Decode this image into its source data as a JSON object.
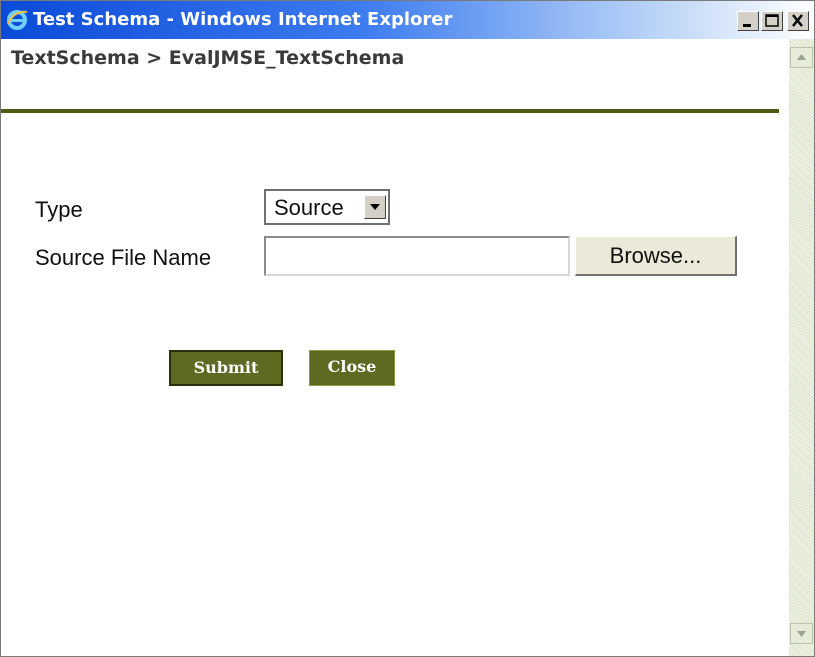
{
  "window": {
    "title": "Test Schema - Windows Internet Explorer",
    "icon": "internet-explorer-icon",
    "controls": [
      "minimize-icon",
      "maximize-icon",
      "close-icon"
    ],
    "title_color": "#0b4ad8"
  },
  "header": {
    "breadcrumb": "TextSchema >  EvalJMSE_TextSchema",
    "rule_color": "#4f5a14"
  },
  "form": {
    "type_label": "Type",
    "type_value": "Source",
    "source_label": "Source File Name",
    "source_value": "",
    "browse_label": "Browse..."
  },
  "actions": {
    "submit_label": "Submit",
    "close_label": "Close",
    "button_color": "#5d6a22"
  }
}
